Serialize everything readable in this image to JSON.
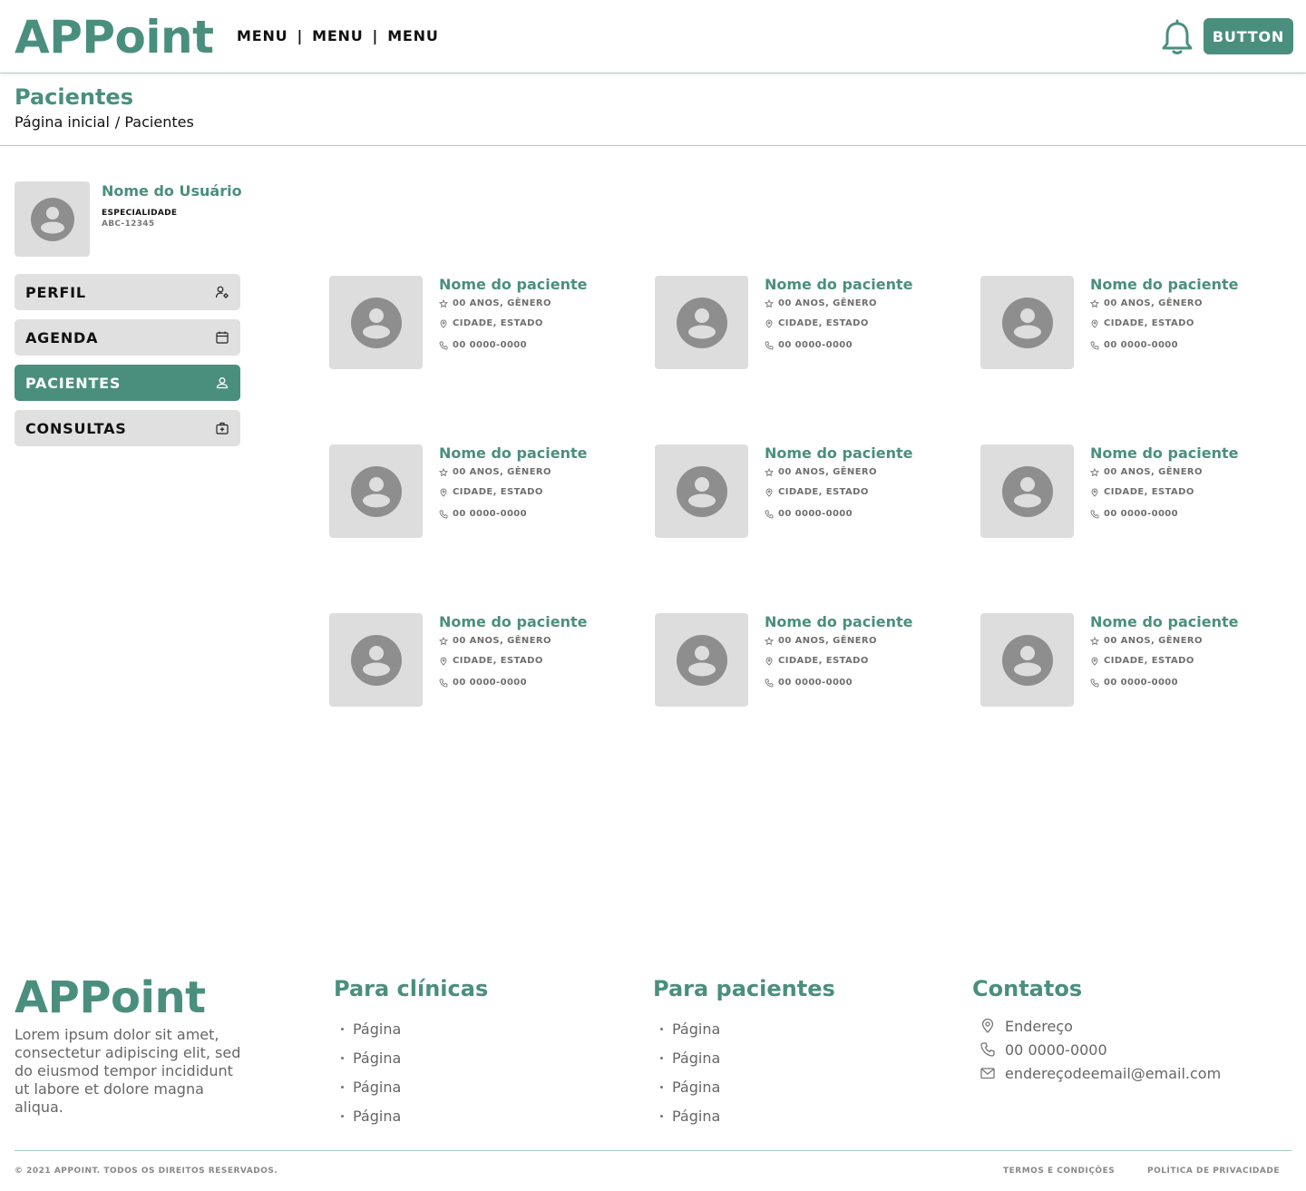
{
  "header": {
    "logo": "APPoint",
    "menu": [
      "MENU",
      "MENU",
      "MENU"
    ],
    "separator": "|",
    "bell_icon": "bell-icon",
    "button_label": "BUTTON"
  },
  "page": {
    "title": "Pacientes",
    "breadcrumb": [
      "Página inicial",
      "/ Pacientes"
    ]
  },
  "user": {
    "name": "Nome do Usuário",
    "specialty": "ESPECIALIDADE",
    "code": "ABC-12345"
  },
  "sidebar": {
    "items": [
      {
        "label": "PERFIL",
        "icon": "user-settings-icon",
        "active": false
      },
      {
        "label": "AGENDA",
        "icon": "calendar-icon",
        "active": false
      },
      {
        "label": "PACIENTES",
        "icon": "user-icon",
        "active": true
      },
      {
        "label": "CONSULTAS",
        "icon": "medical-kit-icon",
        "active": false
      }
    ]
  },
  "patients": [
    {
      "name": "Nome do paciente",
      "age_gender": "00 ANOS, GÊNERO",
      "location": "CIDADE, ESTADO",
      "phone": "00 0000-0000"
    },
    {
      "name": "Nome do paciente",
      "age_gender": "00 ANOS, GÊNERO",
      "location": "CIDADE, ESTADO",
      "phone": "00 0000-0000"
    },
    {
      "name": "Nome do paciente",
      "age_gender": "00 ANOS, GÊNERO",
      "location": "CIDADE, ESTADO",
      "phone": "00 0000-0000"
    },
    {
      "name": "Nome do paciente",
      "age_gender": "00 ANOS, GÊNERO",
      "location": "CIDADE, ESTADO",
      "phone": "00 0000-0000"
    },
    {
      "name": "Nome do paciente",
      "age_gender": "00 ANOS, GÊNERO",
      "location": "CIDADE, ESTADO",
      "phone": "00 0000-0000"
    },
    {
      "name": "Nome do paciente",
      "age_gender": "00 ANOS, GÊNERO",
      "location": "CIDADE, ESTADO",
      "phone": "00 0000-0000"
    },
    {
      "name": "Nome do paciente",
      "age_gender": "00 ANOS, GÊNERO",
      "location": "CIDADE, ESTADO",
      "phone": "00 0000-0000"
    },
    {
      "name": "Nome do paciente",
      "age_gender": "00 ANOS, GÊNERO",
      "location": "CIDADE, ESTADO",
      "phone": "00 0000-0000"
    },
    {
      "name": "Nome do paciente",
      "age_gender": "00 ANOS, GÊNERO",
      "location": "CIDADE, ESTADO",
      "phone": "00 0000-0000"
    }
  ],
  "footer": {
    "logo": "APPoint",
    "description": "Lorem ipsum dolor sit amet, consectetur adipiscing elit, sed do eiusmod tempor incididunt ut labore et dolore magna aliqua.",
    "clinics": {
      "title": "Para clínicas",
      "links": [
        "Página",
        "Página",
        "Página",
        "Página"
      ]
    },
    "patients": {
      "title": "Para pacientes",
      "links": [
        "Página",
        "Página",
        "Página",
        "Página"
      ]
    },
    "contacts": {
      "title": "Contatos",
      "address": "Endereço",
      "phone": "00 0000-0000",
      "email": "endereçodeemail@email.com"
    },
    "copyright": "© 2021 APPOINT. TODOS OS DIREITOS RESERVADOS.",
    "terms": "TERMOS E CONDIÇÕES",
    "privacy": "POLÍTICA DE PRIVACIDADE"
  },
  "colors": {
    "accent": "#4a8f7e",
    "placeholder": "#dddddd",
    "avatar_icon": "#8e8e8e"
  }
}
